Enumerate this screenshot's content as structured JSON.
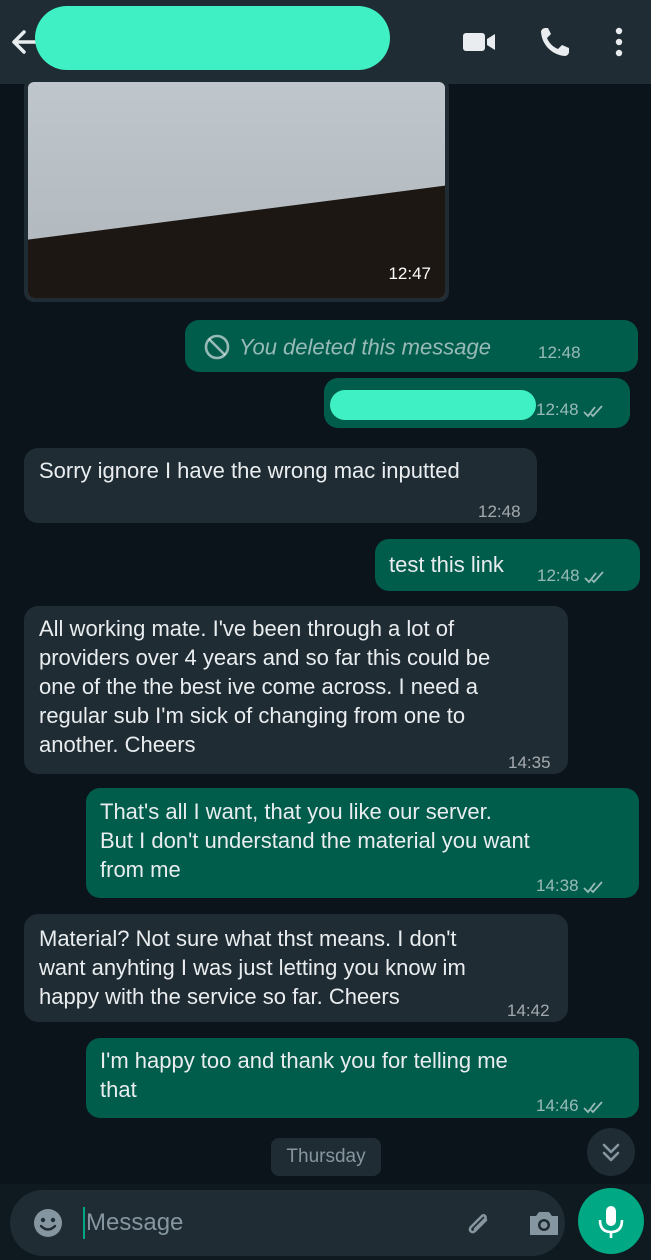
{
  "header": {
    "back_icon": "arrow-left-icon",
    "video_icon": "video-camera-icon",
    "call_icon": "phone-icon",
    "menu_icon": "more-vertical-icon"
  },
  "messages": [
    {
      "kind": "image",
      "direction": "in",
      "time": "12:47"
    },
    {
      "kind": "deleted",
      "direction": "out",
      "text": "You deleted this message",
      "time": "12:48"
    },
    {
      "kind": "redacted",
      "direction": "out",
      "time": "12:48",
      "status": "read"
    },
    {
      "kind": "text",
      "direction": "in",
      "lines": [
        "Sorry ignore I have the wrong mac inputted"
      ],
      "time": "12:48"
    },
    {
      "kind": "text",
      "direction": "out",
      "lines": [
        "test this link"
      ],
      "time": "12:48",
      "status": "read"
    },
    {
      "kind": "text",
      "direction": "in",
      "lines": [
        "All working mate. I've been through a lot of",
        "providers over 4 years and so far this could be",
        "one of the the best ive come across. I need a",
        "regular sub I'm sick of changing from one to",
        "another. Cheers"
      ],
      "time": "14:35"
    },
    {
      "kind": "text",
      "direction": "out",
      "lines": [
        "That's all I want, that you like our server.",
        "But I don't understand the material you want",
        "from me"
      ],
      "time": "14:38",
      "status": "read"
    },
    {
      "kind": "text",
      "direction": "in",
      "lines": [
        "Material? Not sure what thst means. I don't",
        "want anyhting I was just letting you know im",
        "happy with the service so far. Cheers"
      ],
      "time": "14:42"
    },
    {
      "kind": "text",
      "direction": "out",
      "lines": [
        "I'm happy too and thank you for telling me",
        "that"
      ],
      "time": "14:46",
      "status": "read"
    }
  ],
  "date_divider": "Thursday",
  "composer": {
    "placeholder": "Message",
    "emoji_icon": "emoji-icon",
    "attach_icon": "paperclip-icon",
    "camera_icon": "camera-icon",
    "mic_icon": "microphone-icon"
  },
  "colors": {
    "background": "#0b141a",
    "incoming_bubble": "#1f2c33",
    "outgoing_bubble": "#005c4b",
    "accent": "#00a884",
    "redaction": "#3ff0c4"
  }
}
